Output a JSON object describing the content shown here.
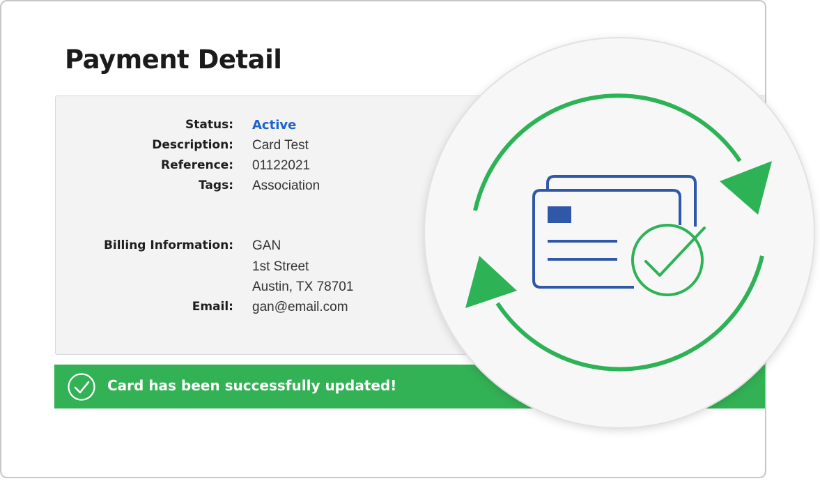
{
  "page": {
    "title": "Payment Detail"
  },
  "details": {
    "status_label": "Status:",
    "status_value": "Active",
    "description_label": "Description:",
    "description_value": "Card Test",
    "reference_label": "Reference:",
    "reference_value": "01122021",
    "tags_label": "Tags:",
    "tags_value": "Association",
    "billing_label": "Billing Information:",
    "billing_name": "GAN",
    "billing_street": "1st Street",
    "billing_city": "Austin, TX 78701",
    "email_label": "Email:",
    "email_value": "gan@email.com"
  },
  "alert": {
    "message": "Card has been successfully updated!",
    "icon": "check-circle-icon"
  },
  "badge": {
    "icon": "card-refresh-success-icon"
  },
  "colors": {
    "status_active": "#1d63c9",
    "success_green": "#33b155",
    "card_blue": "#2f58a8",
    "badge_green": "#2db256"
  }
}
